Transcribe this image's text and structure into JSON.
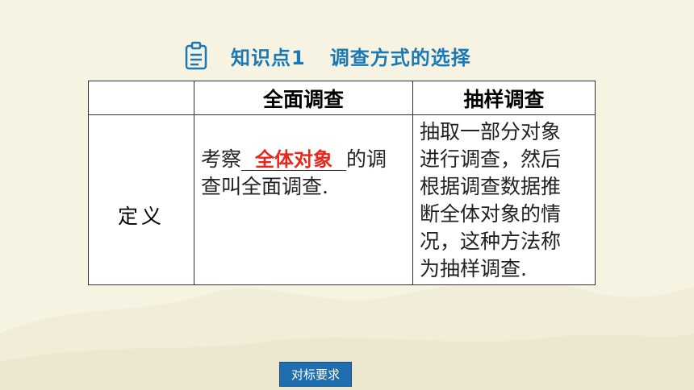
{
  "header": {
    "icon": "clipboard-icon",
    "label": "知识点1",
    "title": "调查方式的选择"
  },
  "table": {
    "corner": "",
    "columns": [
      "全面调查",
      "抽样调查"
    ],
    "row": {
      "label": "定义",
      "full_prefix": "考察",
      "full_answer": "全体对象",
      "full_suffix": "的调",
      "full_line2": "查叫全面调查.",
      "sample_lines": [
        "抽取一部分对象",
        "进行调查，然后",
        "根据调查数据推",
        "断全体对象的情",
        "况，这种方法称",
        "为抽样调查."
      ]
    }
  },
  "footer": {
    "button_label": "对标要求"
  },
  "colors": {
    "accent": "#1a78b4",
    "answer": "#e8281c",
    "button": "#1f6fb0",
    "background": "#f7f3e3"
  }
}
